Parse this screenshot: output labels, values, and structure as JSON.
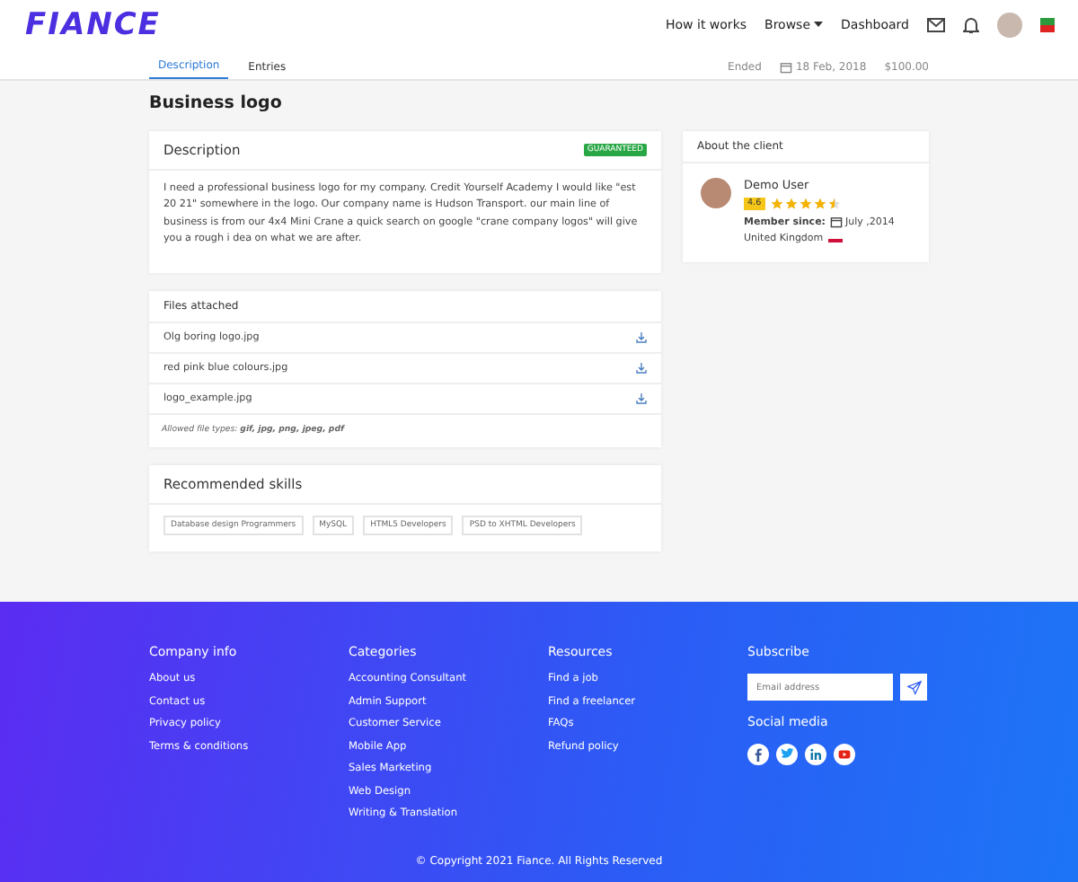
{
  "header": {
    "logo": "FIANCE",
    "nav": [
      {
        "label": "How it works",
        "kind": "link"
      },
      {
        "label": "Browse",
        "kind": "dropdown"
      },
      {
        "label": "Dashboard",
        "kind": "link"
      }
    ]
  },
  "tabs": [
    {
      "label": "Description",
      "selected": true
    },
    {
      "label": "Entries",
      "selected": false
    }
  ],
  "contest": {
    "status": "Ended",
    "date": "18 Feb, 2018",
    "prize": "$100.00"
  },
  "page_title": "Business logo",
  "description": {
    "title": "Description",
    "badge": "GUARANTEED",
    "text": "I need a professional business logo for my company. Credit Yourself Academy I would like \"est 20 21\" somewhere in the logo. Our company name is Hudson Transport. our main line of business is from our 4x4 Mini Crane a quick search on google \"crane company logos\" will give you a rough i dea on what we are after."
  },
  "files": {
    "title": "Files attached",
    "items": [
      "Olg boring logo.jpg",
      "red pink blue colours.jpg",
      "logo_example.jpg"
    ],
    "allowed": "Allowed file types: **gif, jpg, png, jpeg, pdf**"
  },
  "skills": {
    "title": "Recommended skills",
    "items": [
      "Database design Programmers",
      "MySQL",
      "HTML5 Developers",
      "PSD to XHTML Developers"
    ]
  },
  "client": {
    "title": "About the client",
    "name": "Demo User",
    "rating": "4.6",
    "stars": 4.5,
    "member_label": "Member since:",
    "member_date": "July ,2014",
    "country": "United Kingdom"
  },
  "footer": {
    "columns": [
      {
        "title": "Company info",
        "links": [
          "About us",
          "Contact us",
          "Privacy policy",
          "Terms & conditions"
        ]
      },
      {
        "title": "Categories",
        "links": [
          "Accounting Consultant",
          "Admin Support",
          "Customer Service",
          "Mobile App",
          "Sales Marketing",
          "Web Design",
          "Writing & Translation"
        ]
      },
      {
        "title": "Resources",
        "links": [
          "Find a job",
          "Find a freelancer",
          "FAQs",
          "Refund policy"
        ]
      }
    ],
    "subscribe_title": "Subscribe",
    "email_placeholder": "Email address",
    "social_title": "Social media",
    "social": [
      {
        "kind": "facebook"
      },
      {
        "kind": "twitter"
      },
      {
        "kind": "linkedin"
      },
      {
        "kind": "youtube"
      }
    ],
    "copyright": "© Copyright 2021 Fiance. All Rights Reserved"
  }
}
